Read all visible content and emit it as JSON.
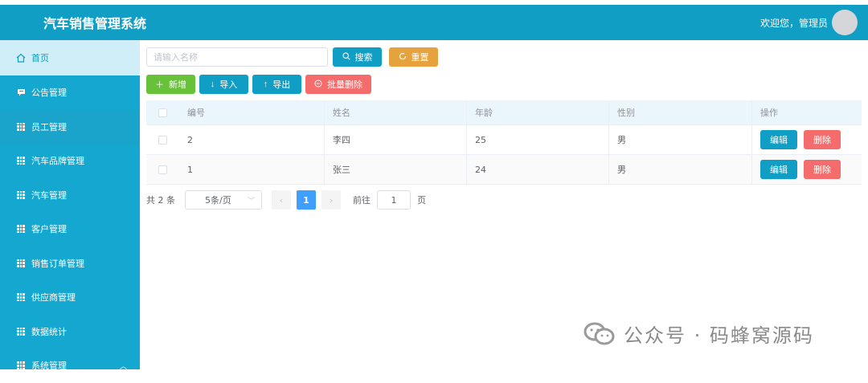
{
  "header": {
    "title": "汽车销售管理系统",
    "welcome": "欢迎您，管理员"
  },
  "sidebar": {
    "items": [
      {
        "label": "首页",
        "icon": "home-icon"
      },
      {
        "label": "公告管理",
        "icon": "message-icon"
      },
      {
        "label": "员工管理",
        "icon": "grid-icon"
      },
      {
        "label": "汽车品牌管理",
        "icon": "grid-icon"
      },
      {
        "label": "汽车管理",
        "icon": "grid-icon"
      },
      {
        "label": "客户管理",
        "icon": "grid-icon"
      },
      {
        "label": "销售订单管理",
        "icon": "grid-icon"
      },
      {
        "label": "供应商管理",
        "icon": "grid-icon"
      },
      {
        "label": "数据统计",
        "icon": "grid-icon"
      },
      {
        "label": "系统管理",
        "icon": "grid-icon"
      }
    ]
  },
  "search": {
    "placeholder": "请输入名称",
    "search_label": "搜索",
    "reset_label": "重置"
  },
  "toolbar": {
    "add_label": "新增",
    "import_label": "导入",
    "export_label": "导出",
    "batch_delete_label": "批量删除"
  },
  "table": {
    "headers": [
      "编号",
      "姓名",
      "年龄",
      "性别",
      "操作"
    ],
    "rows": [
      {
        "id": "2",
        "name": "李四",
        "age": "25",
        "sex": "男"
      },
      {
        "id": "1",
        "name": "张三",
        "age": "24",
        "sex": "男"
      }
    ],
    "edit_label": "编辑",
    "delete_label": "删除"
  },
  "pagination": {
    "total_text": "共 2 条",
    "page_size": "5条/页",
    "current_page": "1",
    "goto_prefix": "前往",
    "goto_value": "1",
    "goto_suffix": "页"
  },
  "watermark": {
    "text": "公众号 · 码蜂窝源码"
  },
  "colors": {
    "primary": "#119ec4",
    "sidebar": "#14a7cf",
    "success": "#67c23a",
    "warning": "#e6a23c",
    "danger": "#f56c6c",
    "page_active": "#409eff"
  }
}
